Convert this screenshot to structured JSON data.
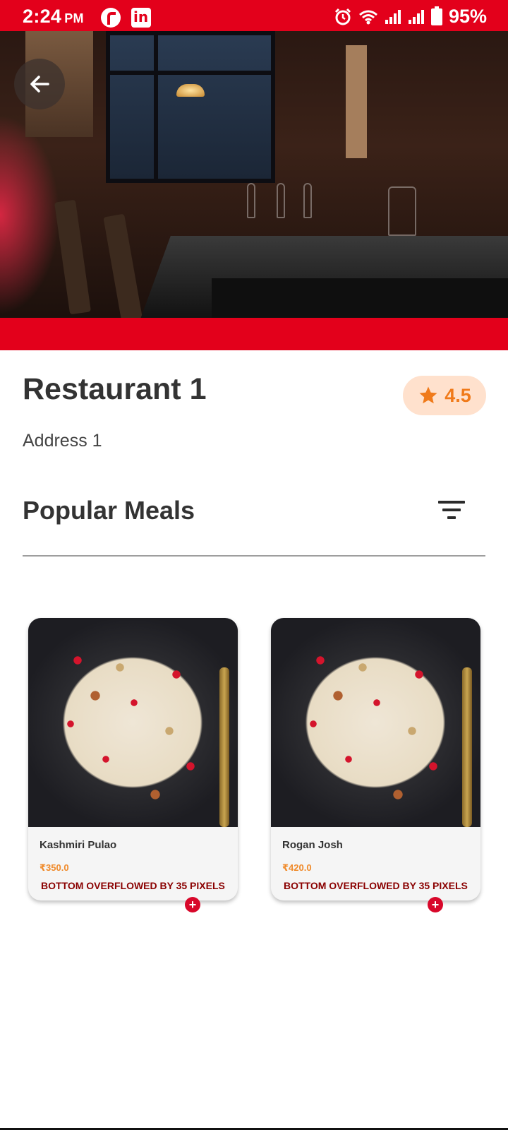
{
  "status_bar": {
    "time": "2:24",
    "ampm": "PM",
    "battery": "95%",
    "icons": [
      "r-app-icon",
      "linkedin-icon",
      "alarm-icon",
      "wifi-icon",
      "signal-icon",
      "signal-icon",
      "battery-charging-icon"
    ]
  },
  "colors": {
    "brand_red": "#e3001b",
    "rating_bg": "#ffe1cd",
    "rating_fg": "#f07a1a",
    "price": "#f08a2a"
  },
  "restaurant": {
    "name": "Restaurant 1",
    "address": "Address 1",
    "rating": "4.5"
  },
  "section": {
    "title": "Popular Meals"
  },
  "meals": [
    {
      "name": "Kashmiri Pulao",
      "price": "₹350.0",
      "overflow_msg": "BOTTOM OVERFLOWED BY 35 PIXELS",
      "add_label": "+"
    },
    {
      "name": "Rogan Josh",
      "price": "₹420.0",
      "overflow_msg": "BOTTOM OVERFLOWED BY 35 PIXELS",
      "add_label": "+"
    }
  ]
}
